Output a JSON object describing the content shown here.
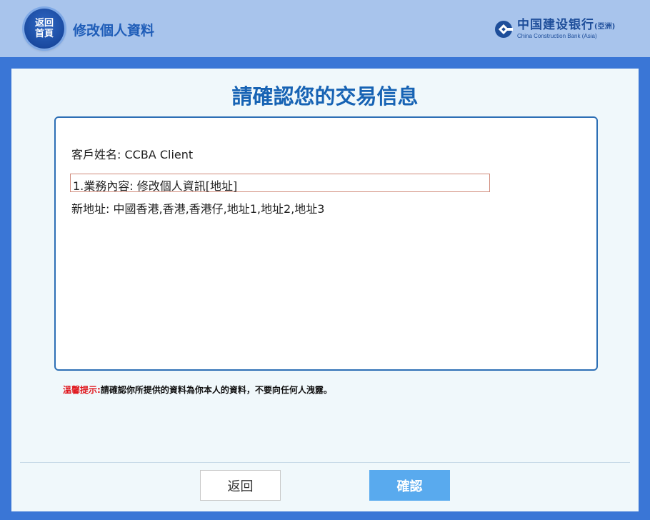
{
  "header": {
    "home_label_line1": "返回",
    "home_label_line2": "首頁",
    "title": "修改個人資料",
    "brand_cn": "中国建设银行",
    "brand_cn_suffix": "(亞洲)",
    "brand_en": "China Construction Bank (Asia)"
  },
  "main": {
    "title": "請確認您的交易信息",
    "customer_name": "客戶姓名: CCBA Client",
    "business": "1.業務內容: 修改個人資訊[地址]",
    "new_address": "新地址: 中國香港,香港,香港仔,地址1,地址2,地址3"
  },
  "tip": {
    "label": "溫馨提示:",
    "text": "請確認你所提供的資料為你本人的資料，不要向任何人洩露。"
  },
  "buttons": {
    "back": "返回",
    "confirm": "確認"
  },
  "colors": {
    "header_bg": "#a8c4ec",
    "frame_blue": "#3a76d6",
    "title_blue": "#1763b4",
    "confirm_button": "#59aaee",
    "tip_red": "#e0191f"
  }
}
